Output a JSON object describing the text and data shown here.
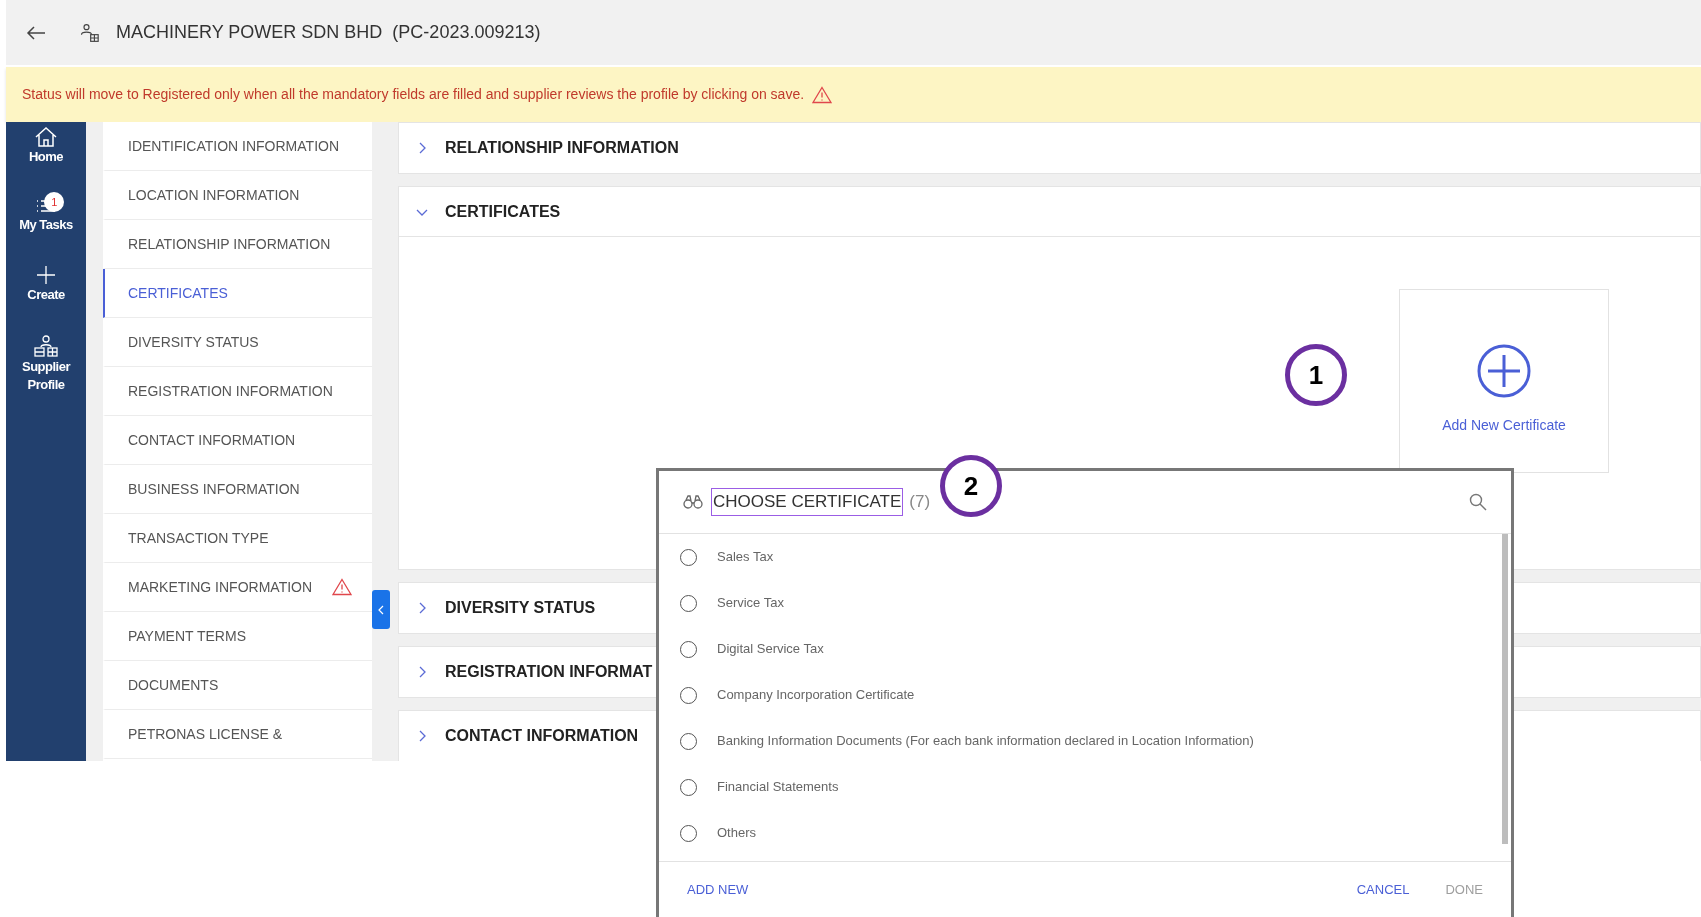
{
  "header": {
    "title": "MACHINERY POWER SDN BHD  (PC-2023.009213)"
  },
  "banner": {
    "text": "Status will move to Registered only when all the mandatory fields are filled and supplier reviews the profile by clicking on save."
  },
  "nav": [
    {
      "label": "Home",
      "kind": "home"
    },
    {
      "label": "My Tasks",
      "kind": "tasks",
      "badge": "1"
    },
    {
      "label": "Create",
      "kind": "create"
    },
    {
      "label": "Supplier Profile",
      "kind": "profile"
    }
  ],
  "sidebar": {
    "items": [
      {
        "label": "IDENTIFICATION INFORMATION",
        "selected": false,
        "warning": false
      },
      {
        "label": "LOCATION INFORMATION",
        "selected": false,
        "warning": false
      },
      {
        "label": "RELATIONSHIP INFORMATION",
        "selected": false,
        "warning": false
      },
      {
        "label": "CERTIFICATES",
        "selected": true,
        "warning": false
      },
      {
        "label": "DIVERSITY STATUS",
        "selected": false,
        "warning": false
      },
      {
        "label": "REGISTRATION INFORMATION",
        "selected": false,
        "warning": false
      },
      {
        "label": "CONTACT INFORMATION",
        "selected": false,
        "warning": false
      },
      {
        "label": "BUSINESS INFORMATION",
        "selected": false,
        "warning": false
      },
      {
        "label": "TRANSACTION TYPE",
        "selected": false,
        "warning": false
      },
      {
        "label": "MARKETING INFORMATION",
        "selected": false,
        "warning": true
      },
      {
        "label": "PAYMENT TERMS",
        "selected": false,
        "warning": false
      },
      {
        "label": "DOCUMENTS",
        "selected": false,
        "warning": false
      },
      {
        "label": "PETRONAS LICENSE &",
        "selected": false,
        "warning": false
      }
    ]
  },
  "sections": [
    {
      "title": "RELATIONSHIP INFORMATION",
      "expanded": false
    },
    {
      "title": "CERTIFICATES",
      "expanded": true,
      "add_card": {
        "label": "Add New Certificate"
      }
    },
    {
      "title": "DIVERSITY STATUS",
      "expanded": false
    },
    {
      "title": "REGISTRATION INFORMAT",
      "expanded": false
    },
    {
      "title": "CONTACT INFORMATION",
      "expanded": false
    }
  ],
  "dialog": {
    "title": "CHOOSE CERTIFICATE",
    "count": "(7)",
    "options": [
      {
        "label": "Sales Tax",
        "selected": false
      },
      {
        "label": "Service Tax",
        "selected": false
      },
      {
        "label": "Digital Service Tax",
        "selected": false
      },
      {
        "label": "Company Incorporation Certificate",
        "selected": false
      },
      {
        "label": "Banking Information Documents (For each bank information declared in Location Information)",
        "selected": false
      },
      {
        "label": "Financial Statements",
        "selected": false
      },
      {
        "label": "Others",
        "selected": false
      }
    ],
    "footer_left": [
      {
        "label": "ADD NEW",
        "disabled": false
      }
    ],
    "footer_right": [
      {
        "label": "CANCEL",
        "disabled": false
      },
      {
        "label": "DONE",
        "disabled": true
      }
    ]
  },
  "annotations": [
    "1",
    "2"
  ]
}
